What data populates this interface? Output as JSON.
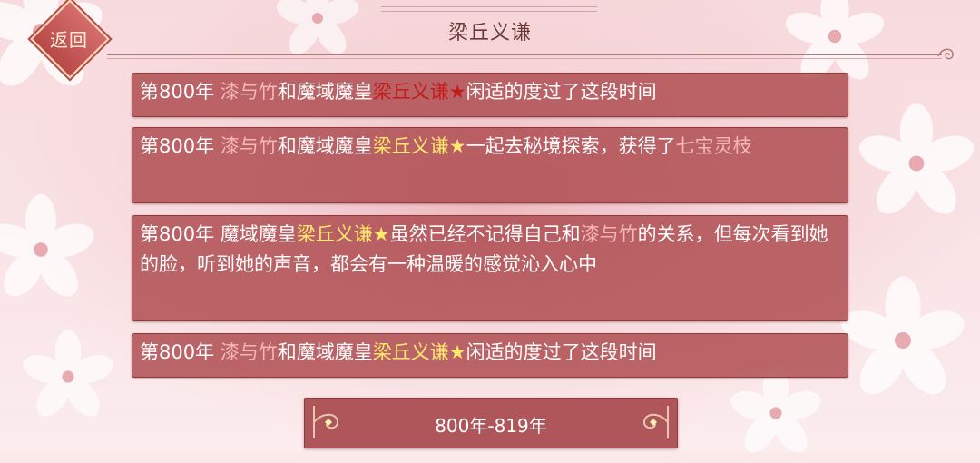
{
  "header": {
    "title": "梁丘义谦",
    "back_label": "返回"
  },
  "entries": [
    {
      "segments": [
        {
          "text": "第800年 ",
          "style": "plain"
        },
        {
          "text": "漆与竹",
          "style": "pink"
        },
        {
          "text": "和魔域魔皇",
          "style": "plain"
        },
        {
          "text": "梁丘义谦★",
          "style": "red"
        },
        {
          "text": "闲适的度过了这段时间",
          "style": "plain"
        }
      ]
    },
    {
      "segments": [
        {
          "text": "第800年 ",
          "style": "plain"
        },
        {
          "text": "漆与竹",
          "style": "pink"
        },
        {
          "text": "和魔域魔皇",
          "style": "plain"
        },
        {
          "text": "梁丘义谦★",
          "style": "gold"
        },
        {
          "text": "一起去秘境探索，获得了",
          "style": "plain"
        },
        {
          "text": "七宝灵枝",
          "style": "pink"
        }
      ]
    },
    {
      "segments": [
        {
          "text": "第800年 魔域魔皇",
          "style": "plain"
        },
        {
          "text": "梁丘义谦★",
          "style": "gold"
        },
        {
          "text": "虽然已经不记得自己和",
          "style": "plain"
        },
        {
          "text": "漆与竹",
          "style": "pink"
        },
        {
          "text": "的关系，但每次看到她的脸，听到她的声音，都会有一种温暖的感觉沁入心中",
          "style": "plain"
        }
      ]
    },
    {
      "segments": [
        {
          "text": "第800年 ",
          "style": "plain"
        },
        {
          "text": "漆与竹",
          "style": "pink"
        },
        {
          "text": "和魔域魔皇",
          "style": "plain"
        },
        {
          "text": "梁丘义谦★",
          "style": "gold"
        },
        {
          "text": "闲适的度过了这段时间",
          "style": "plain"
        }
      ]
    }
  ],
  "footer": {
    "range_label": "800年-819年"
  },
  "colors": {
    "highlight_pink": "#f6b7b7",
    "highlight_gold": "#ffe96e",
    "highlight_red": "#c41a1a",
    "panel": "#ac484c"
  },
  "icons": [
    "flower-icon",
    "back-diamond-icon",
    "scroll-ornament-icon"
  ]
}
